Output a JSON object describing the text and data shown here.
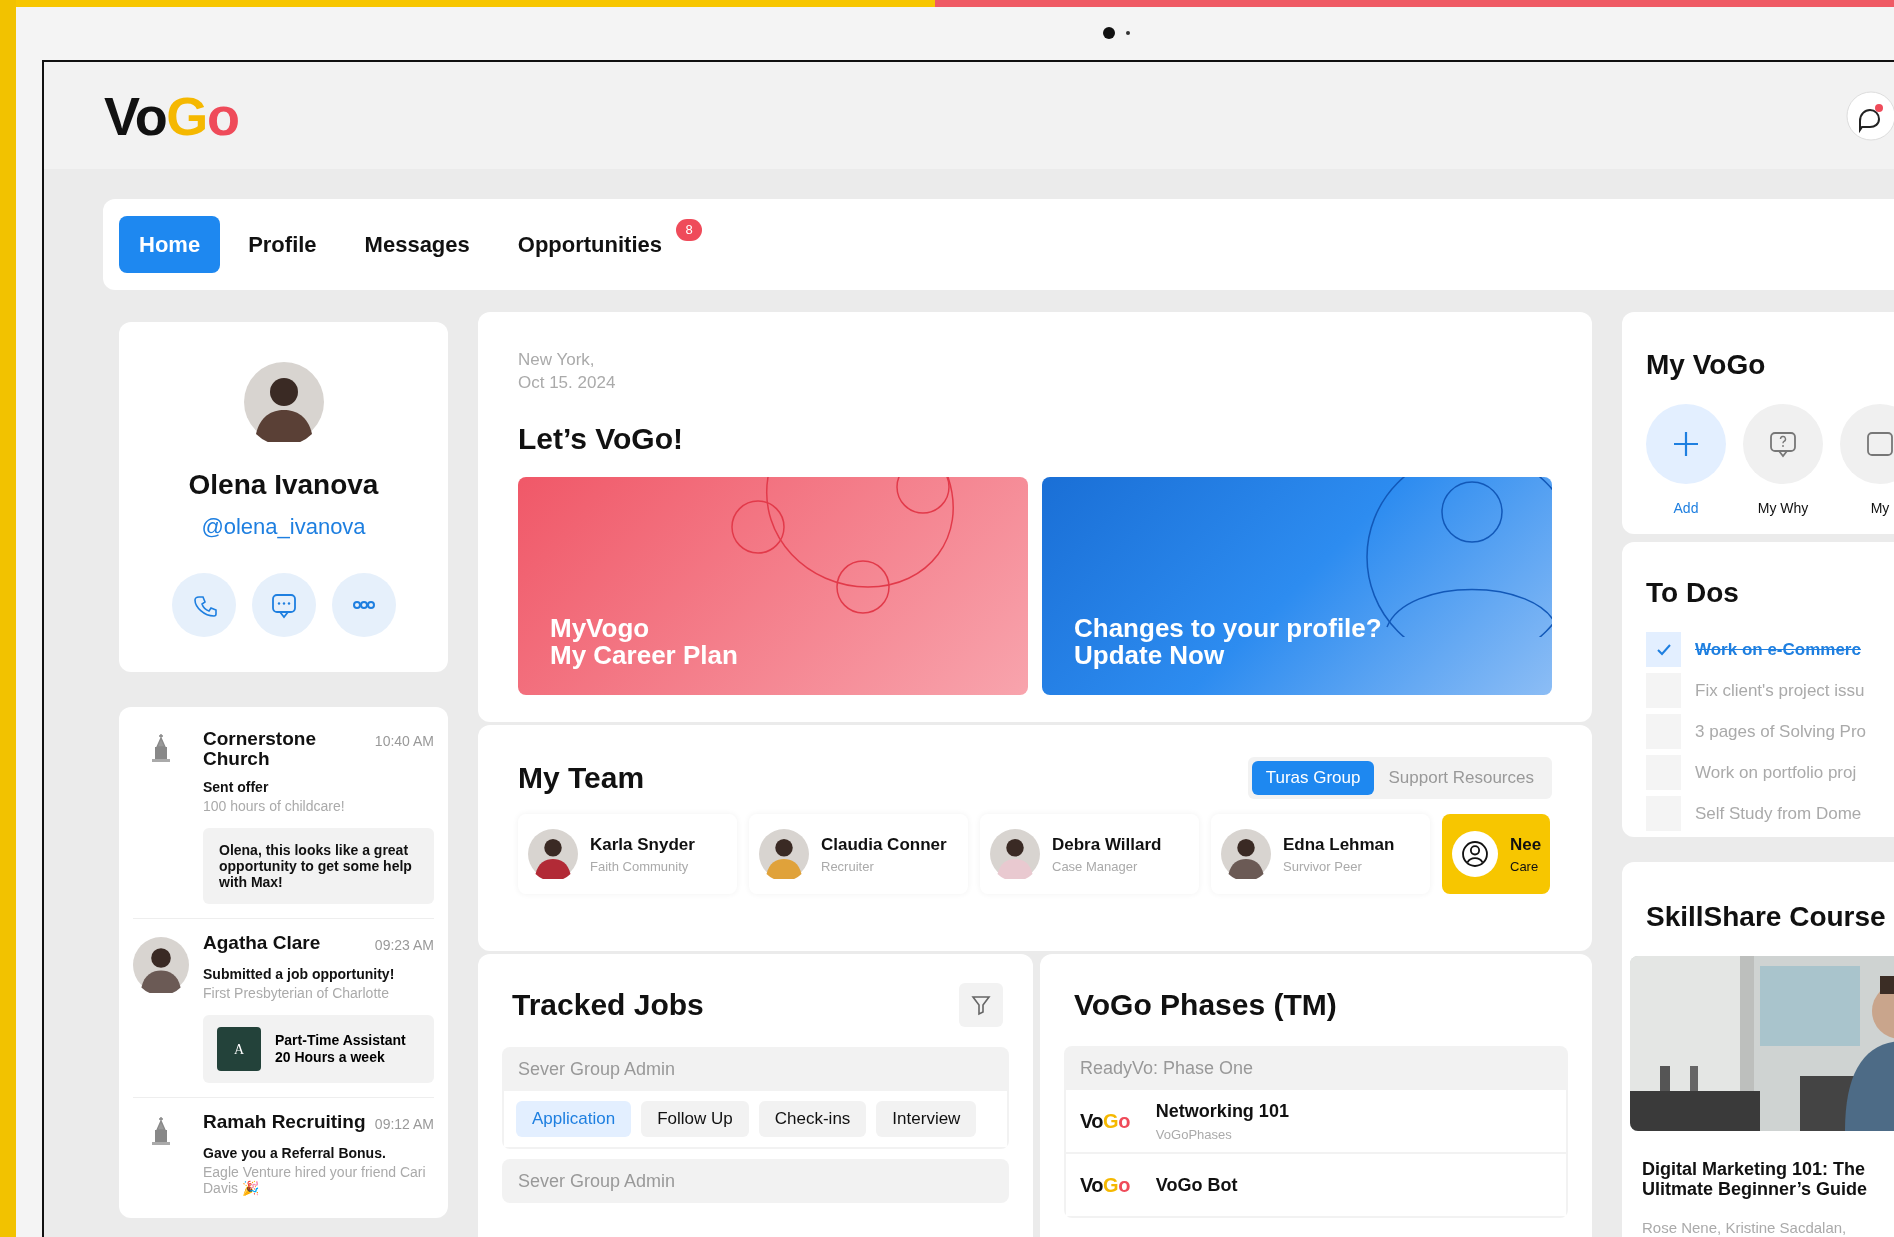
{
  "logo": [
    "Vo",
    "G",
    "o"
  ],
  "nav": {
    "tabs": [
      {
        "label": "Home",
        "selected": true
      },
      {
        "label": "Profile",
        "selected": false
      },
      {
        "label": "Messages",
        "selected": false
      },
      {
        "label": "Opportunities",
        "selected": false,
        "badge": "8"
      }
    ]
  },
  "profile": {
    "name": "Olena Ivanova",
    "handle": "@olena_ivanova"
  },
  "feed": [
    {
      "kind": "org",
      "sender": "Cornerstone Church",
      "time": "10:40 AM",
      "action": "Sent offer",
      "detail": "100 hours of childcare!",
      "note": "Olena, this looks like a great opportunity to get some help with Max!"
    },
    {
      "kind": "person",
      "sender": "Agatha Clare",
      "time": "09:23 AM",
      "action": "Submitted  a job opportunity!",
      "detail": "First Presbyterian of Charlotte",
      "job": {
        "thumb": "A",
        "title": "Part-Time Assistant",
        "hours": "20 Hours a week"
      }
    },
    {
      "kind": "org",
      "sender": "Ramah Recruiting",
      "time": "09:12 AM",
      "action": "Gave you a Referral Bonus.",
      "detail": "Eagle Venture hired your friend Cari Davis 🎉"
    }
  ],
  "welcome": {
    "location": "New York,",
    "date": "Oct 15. 2024",
    "title": "Let’s VoGo!",
    "banners": [
      {
        "kind": "plan",
        "lines": [
          "MyVogo",
          "My Career Plan"
        ]
      },
      {
        "kind": "profile",
        "lines": [
          "Changes to your profile?",
          "Update Now"
        ]
      }
    ]
  },
  "team": {
    "title": "My Team",
    "tabs": [
      {
        "label": "Turas Group",
        "selected": true
      },
      {
        "label": "Support Resources",
        "selected": false
      }
    ],
    "members": [
      {
        "kind": "person",
        "name": "Karla Snyder",
        "role": "Faith Community"
      },
      {
        "kind": "person",
        "name": "Claudia Conner",
        "role": "Recruiter"
      },
      {
        "kind": "person",
        "name": "Debra Willard",
        "role": "Case Manager"
      },
      {
        "kind": "person",
        "name": "Edna Lehman",
        "role": "Survivor Peer"
      },
      {
        "kind": "need",
        "name": "Nee",
        "role": "Care"
      }
    ]
  },
  "tracked_jobs": {
    "title": "Tracked Jobs",
    "groups": [
      {
        "name": "Sever Group Admin",
        "stages": [
          {
            "label": "Application",
            "selected": true
          },
          {
            "label": "Follow Up",
            "selected": false
          },
          {
            "label": "Check-ins",
            "selected": false
          },
          {
            "label": "Interview",
            "selected": false
          }
        ]
      },
      {
        "name": "Sever Group Admin"
      }
    ]
  },
  "phases": {
    "title": "VoGo Phases (TM)",
    "group": "ReadyVo: Phase One",
    "items": [
      {
        "logo": [
          "Vo",
          "G",
          "o"
        ],
        "title": "Networking 101",
        "subtitle": "VoGoPhases"
      },
      {
        "logo": [
          "Vo",
          "G",
          "o"
        ],
        "title": "VoGo Bot"
      }
    ]
  },
  "my_vogo": {
    "title": "My VoGo",
    "actions": [
      {
        "kind": "add",
        "label": "Add"
      },
      {
        "kind": "why",
        "label": "My Why"
      },
      {
        "kind": "other",
        "label": "My"
      }
    ]
  },
  "todos": {
    "title": "To Dos",
    "items": [
      {
        "text": "Work on e-Commerc",
        "checked": true
      },
      {
        "text": "Fix client's project issu",
        "checked": false
      },
      {
        "text": "3 pages of Solving Pro",
        "checked": false
      },
      {
        "text": "Work on portfolio proj",
        "checked": false
      },
      {
        "text": "Self Study from Dome",
        "checked": false
      }
    ]
  },
  "skillshare": {
    "title": "SkillShare Course",
    "course": {
      "kind": "picture",
      "title": "Digital Marketing 101: The Ulitmate Beginner’s Guide",
      "authors": "Rose Nene, Kristine Sacdalan,"
    }
  }
}
